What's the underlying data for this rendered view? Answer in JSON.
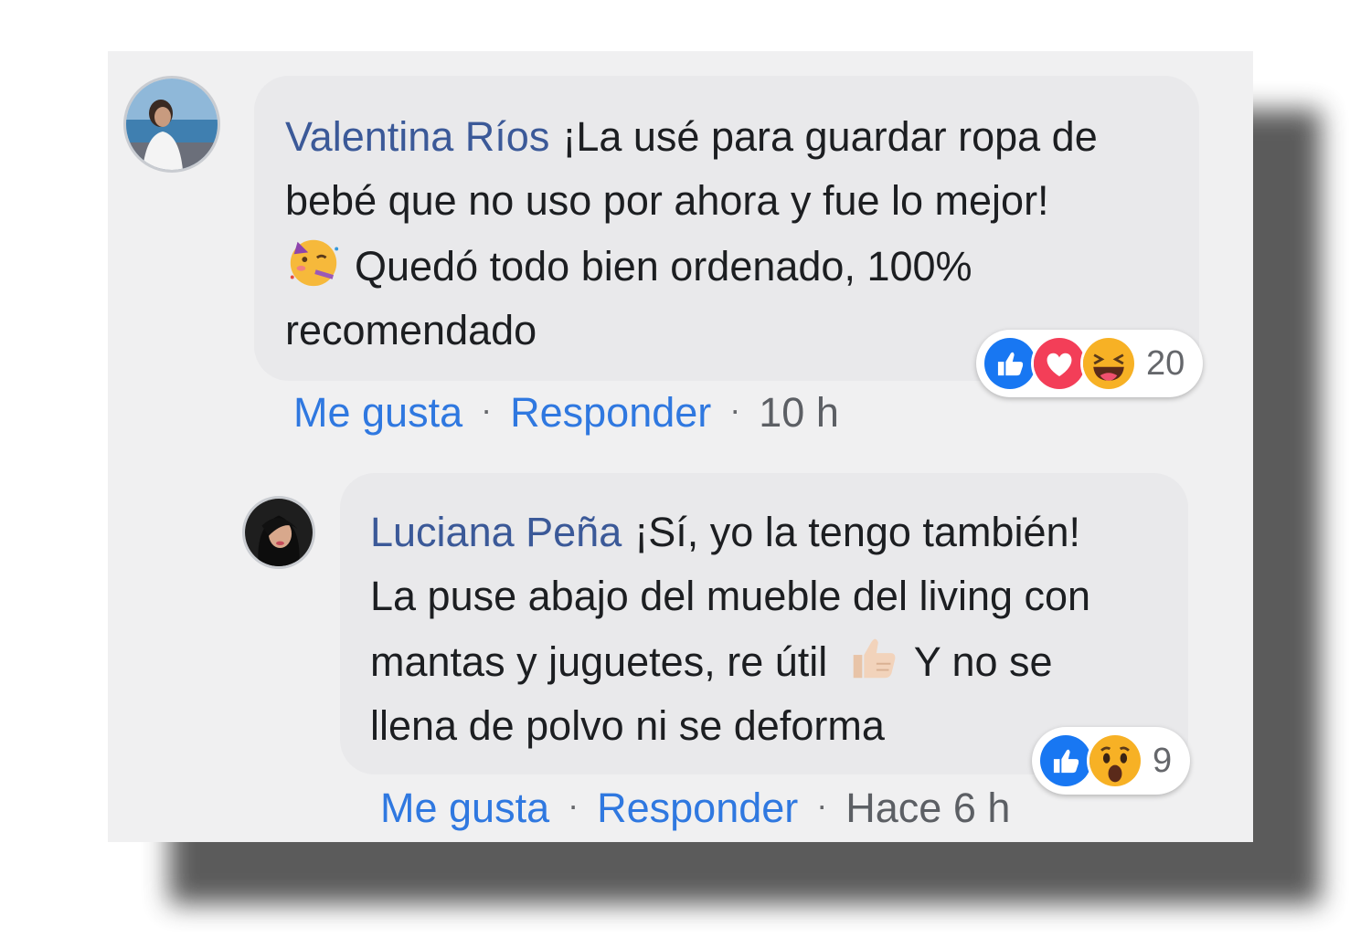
{
  "comments": [
    {
      "author": "Valentina Ríos",
      "line1": "¡La usé para guardar ropa de",
      "line2": "bebé que no uso por ahora y fue lo mejor!",
      "emoji_icon": "partying-face-icon",
      "line3": "Quedó todo bien ordenado, 100%",
      "line4": "recomendado",
      "like_label": "Me gusta",
      "reply_label": "Responder",
      "separator": "·",
      "time": "10 h",
      "reactions": [
        "like-icon",
        "love-icon",
        "haha-icon"
      ],
      "reaction_count": "20"
    },
    {
      "author": "Luciana Peña",
      "line1": "¡Sí, yo la tengo también!",
      "line2": "La puse abajo del mueble del living con",
      "line3a": "mantas y juguetes, re útil",
      "emoji_icon": "thumbs-up-icon",
      "line3b": "Y no se",
      "line4": "llena de polvo ni se deforma",
      "like_label": "Me gusta",
      "reply_label": "Responder",
      "separator": "·",
      "time": "Hace 6 h",
      "reactions": [
        "like-icon",
        "wow-icon"
      ],
      "reaction_count": "9"
    }
  ],
  "colors": {
    "author": "#3b5998",
    "link": "#2f78e0",
    "bubble": "#e9e9eb",
    "card": "#f0f0f1",
    "like": "#1877f2",
    "love": "#f33e58",
    "haha": "#f7b125"
  }
}
